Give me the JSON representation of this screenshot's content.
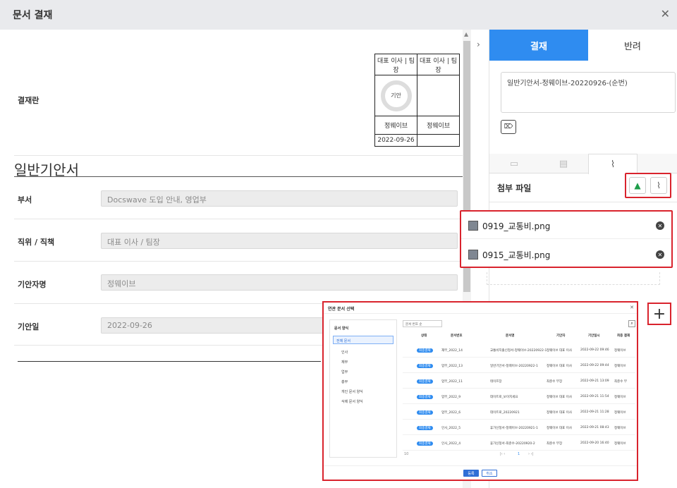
{
  "window": {
    "title": "문서 결재"
  },
  "approval": {
    "label": "결재란",
    "col1_header": "대표 이사 | 팀장",
    "col2_header": "대표 이사 | 팀장",
    "stamp_text": "기안",
    "col1_name": "정웨이브",
    "col2_name": "정웨이브",
    "col1_date": "2022-09-26",
    "col2_date": ""
  },
  "doc": {
    "title": "일반기안서",
    "fields": [
      {
        "label": "부서",
        "value": "Docswave 도입 안내, 영업부"
      },
      {
        "label": "직위 / 직책",
        "value": "대표 이사 / 팀장"
      },
      {
        "label": "기안자명",
        "value": "정웨이브"
      },
      {
        "label": "기안일",
        "value": "2022-09-26"
      }
    ]
  },
  "panel": {
    "tab_approve": "결재",
    "tab_reject": "반려",
    "doc_name": "일반기안서-정웨이브-20220926-(순번)",
    "attach_title": "첨부 파일",
    "files": [
      "0919_교통비.png",
      "0915_교통비.png"
    ]
  },
  "modal": {
    "title": "연관 문서 선택",
    "sidebar_title": "문서 양식",
    "sidebar_selected": "전체 문서",
    "sidebar_items": [
      "인사",
      "재무",
      "업무",
      "총무",
      "개인 문서 양식",
      "삭제 문서 양식"
    ],
    "sort_select": "문서 번호 순",
    "headers": [
      "상태",
      "문서번호",
      "문서명",
      "기안자",
      "기안일시",
      "최종 결재"
    ],
    "rows": [
      {
        "status": "최종결재",
        "no": "재무_2022_14",
        "name": "교통비지출신청서-정웨이브-20220922-1",
        "drafter": "정웨이브 대표 이사",
        "date": "2022-09-22 09:46",
        "final": "정웨이브"
      },
      {
        "status": "최종결재",
        "no": "업무_2022_13",
        "name": "일반기안서-정웨이브-20220922-1",
        "drafter": "정웨이브 대표 이사",
        "date": "2022-09-22 09:44",
        "final": "정웨이브"
      },
      {
        "status": "최종결재",
        "no": "업무_2022_11",
        "name": "테이프장",
        "drafter": "최준수 부장",
        "date": "2022-09-21 13:09",
        "final": "최준수 부"
      },
      {
        "status": "최종결재",
        "no": "업무_2022_9",
        "name": "데이트로_보이지세요",
        "drafter": "정웨이브 대표 이사",
        "date": "2022-09-21 11:54",
        "final": "정웨이브"
      },
      {
        "status": "최종결재",
        "no": "업무_2022_6",
        "name": "데이트로_20220921",
        "drafter": "정웨이브 대표 이사",
        "date": "2022-09-21 11:28",
        "final": "정웨이브"
      },
      {
        "status": "최종결재",
        "no": "인사_2022_5",
        "name": "휴가신청서-정웨이브-20220921-1",
        "drafter": "정웨이브 대표 이사",
        "date": "2022-09-21 08:43",
        "final": "정웨이브"
      },
      {
        "status": "최종결재",
        "no": "인사_2022_4",
        "name": "휴가신청서-최준수-20220920-2",
        "drafter": "최준수 부장",
        "date": "2022-09-20 16:40",
        "final": "정웨이브"
      }
    ],
    "page_size": "10",
    "current_page": "1",
    "btn_ok": "등록",
    "btn_cancel": "취소"
  },
  "colors": {
    "accent": "#2f8cf0",
    "highlight": "#d9232d"
  }
}
